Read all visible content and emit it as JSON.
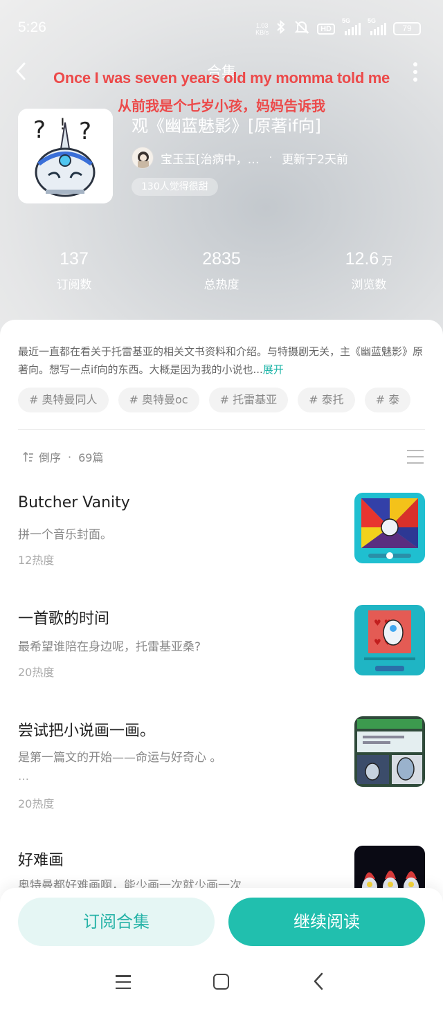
{
  "status_bar": {
    "time": "5:26",
    "net_speed_value": "1.03",
    "net_speed_unit": "KB/s",
    "hd_label": "HD",
    "signal1_label": "5G",
    "signal2_label": "5G",
    "battery": "79"
  },
  "nav": {
    "title": "合集",
    "back_icon": "chevron-left-icon",
    "more_icon": "more-vertical-icon"
  },
  "captions": {
    "line1": "Once I was seven years old my momma told me",
    "line2": "从前我是个七岁小孩，妈妈告诉我",
    "color": "#ec4a4a"
  },
  "collection": {
    "title": "观《幽蓝魅影》[原著if向]",
    "author": "宝玉玉[治病中，…",
    "separator": "·",
    "updated": "更新于2天前",
    "likes": "130人觉得很甜"
  },
  "stats": [
    {
      "value": "137",
      "unit": "",
      "label": "订阅数"
    },
    {
      "value": "2835",
      "unit": "",
      "label": "总热度"
    },
    {
      "value": "12.6",
      "unit": "万",
      "label": "浏览数"
    }
  ],
  "description": {
    "text": "最近一直都在看关于托雷基亚的相关文书资料和介绍。与特摄剧无关，主《幽蓝魅影》原著向。想写一点if向的东西。大概是因为我的小说也...",
    "expand": "展开"
  },
  "tags": [
    "# 奥特曼同人",
    "# 奥特曼oc",
    "# 托雷基亚",
    "# 泰托",
    "# 泰"
  ],
  "list_header": {
    "sort": "倒序",
    "separator": "·",
    "count": "69篇"
  },
  "chapters": [
    {
      "title": "Butcher Vanity",
      "subtitle": "拼一个音乐封面。",
      "more": "",
      "heat": "12热度"
    },
    {
      "title": "一首歌的时间",
      "subtitle": "最希望谁陪在身边呢，托雷基亚桑?",
      "more": "",
      "heat": "20热度"
    },
    {
      "title": "尝试把小说画一画。",
      "subtitle": "是第一篇文的开始——命运与好奇心 。",
      "more": "…",
      "heat": "20热度"
    },
    {
      "title": "好难画",
      "subtitle": "奥特曼都好难画啊，能少画一次就少画一次",
      "more": "",
      "heat": ""
    }
  ],
  "actions": {
    "subscribe": "订阅合集",
    "continue": "继续阅读"
  },
  "colors": {
    "accent": "#21bfae",
    "accent_light": "#e5f6f4"
  },
  "system_nav": {
    "menu_icon": "menu-icon",
    "home_icon": "home-square-icon",
    "back_icon": "back-chevron-icon"
  }
}
